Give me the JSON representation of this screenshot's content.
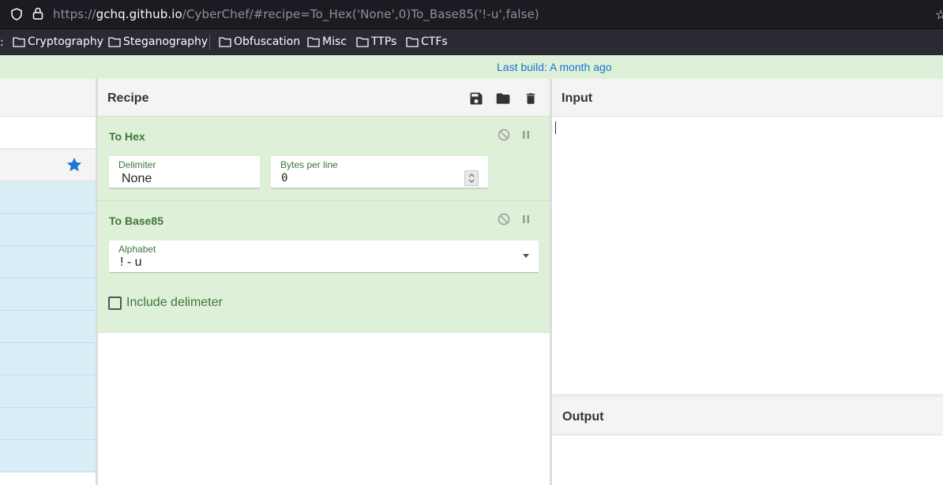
{
  "browser": {
    "url_scheme": "https://",
    "url_host": "gchq.github.io",
    "url_rest": "/CyberChef/#recipe=To_Hex('None',0)To_Base85('!-u',false)"
  },
  "bookmarks": [
    {
      "label": "Cryptography"
    },
    {
      "label": "Steganography"
    },
    {
      "label": "Obfuscation"
    },
    {
      "label": "Misc"
    },
    {
      "label": "TTPs"
    },
    {
      "label": "CTFs"
    }
  ],
  "banner": {
    "text": "Last build: A month ago"
  },
  "recipe": {
    "title": "Recipe",
    "operations": [
      {
        "title": "To Hex",
        "fields": [
          {
            "label": "Delimiter",
            "value": "None"
          },
          {
            "label": "Bytes per line",
            "value": "0"
          }
        ]
      },
      {
        "title": "To Base85",
        "fields": [
          {
            "label": "Alphabet",
            "value": "! - u"
          }
        ],
        "checkbox": {
          "label": "Include delimeter",
          "checked": false
        }
      }
    ]
  },
  "input": {
    "title": "Input"
  },
  "output": {
    "title": "Output"
  },
  "colors": {
    "op_bg": "#dff0d8",
    "op_text": "#3c763d",
    "banner_bg": "#dff0d8",
    "link": "#1976d2",
    "ops_item_bg": "#d9edf7"
  }
}
